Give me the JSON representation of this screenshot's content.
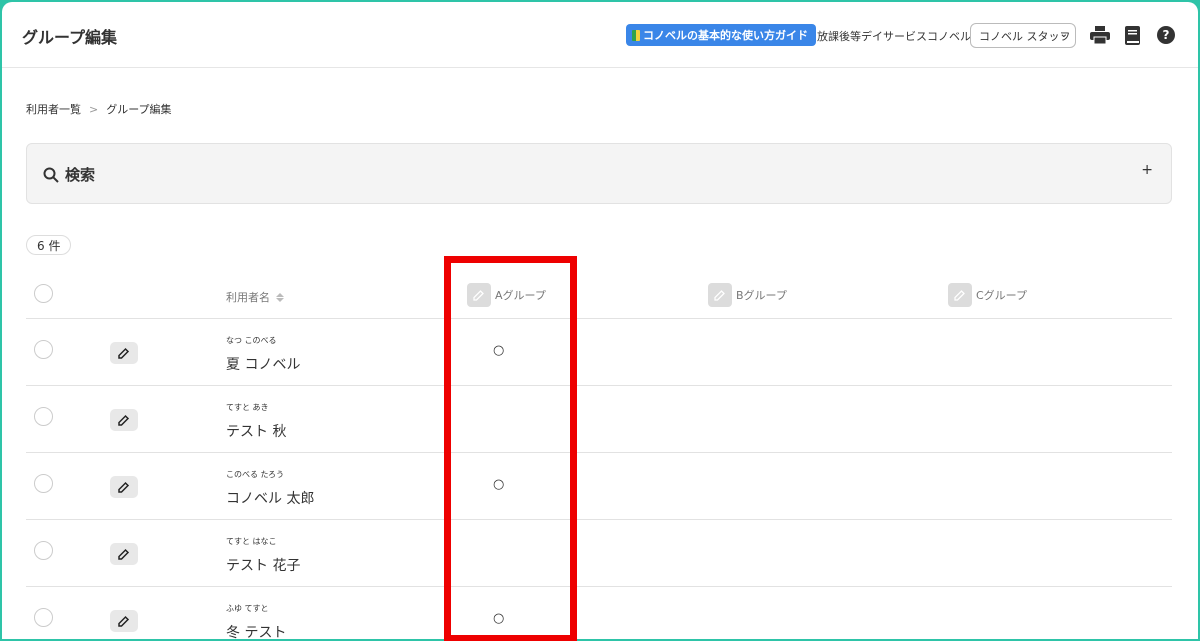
{
  "header": {
    "title": "グループ編集",
    "guide_button": "コノベルの基本的な使い方ガイド",
    "facility_type": "放課後等デイサービス",
    "org_name": "コノベル",
    "staff_select": "コノベル スタッフ",
    "icons": [
      "printer-icon",
      "manual-book-icon",
      "help-icon"
    ]
  },
  "breadcrumb": {
    "items": [
      "利用者一覧",
      "グループ編集"
    ],
    "separator": ">"
  },
  "search": {
    "label": "検索",
    "toggle": "+"
  },
  "count": "6 件",
  "table": {
    "name_header": "利用者名",
    "group_headers": [
      "Aグループ",
      "Bグループ",
      "Cグループ"
    ],
    "rows": [
      {
        "kana": "なつ このべる",
        "name": "夏 コノベル",
        "a": "○",
        "b": "",
        "c": ""
      },
      {
        "kana": "てすと あき",
        "name": "テスト 秋",
        "a": "",
        "b": "",
        "c": ""
      },
      {
        "kana": "このべる たろう",
        "name": "コノベル 太郎",
        "a": "○",
        "b": "",
        "c": ""
      },
      {
        "kana": "てすと はなこ",
        "name": "テスト 花子",
        "a": "",
        "b": "",
        "c": ""
      },
      {
        "kana": "ふゆ てすと",
        "name": "冬 テスト",
        "a": "○",
        "b": "",
        "c": ""
      }
    ]
  },
  "colors": {
    "accent": "#3a86e8",
    "highlight": "#ee0000",
    "frame": "#2ec4a8"
  }
}
